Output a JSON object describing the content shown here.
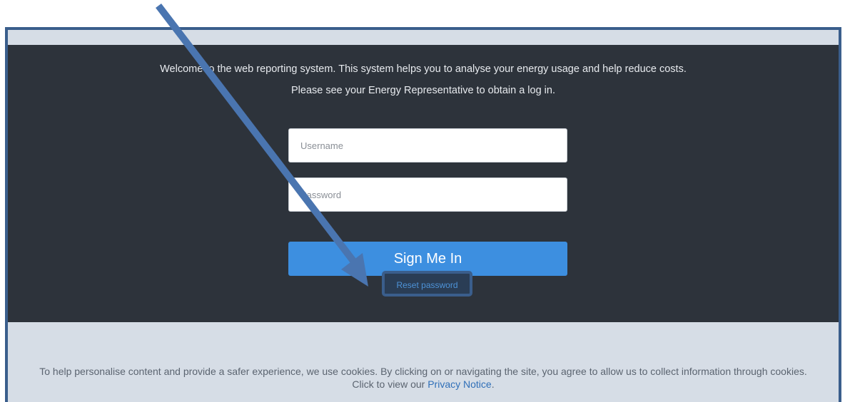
{
  "login": {
    "welcome_text": "Welcome to the web reporting system. This system helps you to analyse your energy usage and help reduce costs.",
    "obtain_text": "Please see your Energy Representative to obtain a log in.",
    "username_placeholder": "Username",
    "password_placeholder": "Password",
    "sign_in_label": "Sign Me In",
    "reset_label": "Reset password"
  },
  "cookie_notice": {
    "text": "To help personalise content and provide a safer experience, we use cookies. By clicking on or navigating the site, you agree to allow us to collect information through cookies.",
    "click_text": "Click to view our",
    "privacy_link": "Privacy Notice",
    "period": "."
  },
  "colors": {
    "panel_bg": "#2d333b",
    "button_bg": "#3d8fe0",
    "annotation_arrow": "#4a75b0",
    "link": "#2f6fb8"
  }
}
